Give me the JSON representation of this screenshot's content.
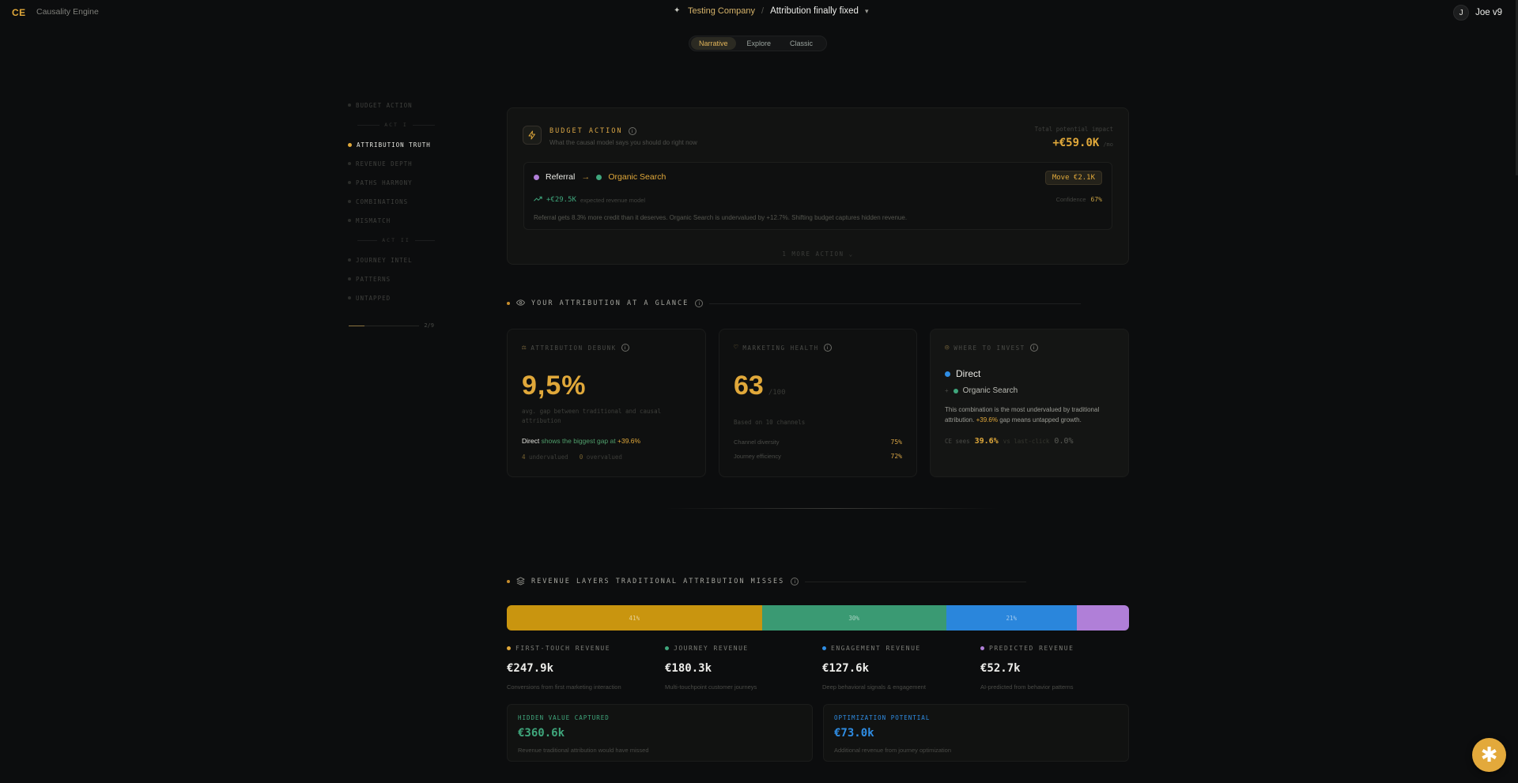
{
  "app": {
    "logo": "CE",
    "name": "Causality Engine"
  },
  "breadcrumb": {
    "company": "Testing Company",
    "separator": "/",
    "project": "Attribution finally fixed"
  },
  "user": {
    "initial": "J",
    "name": "Joe v9"
  },
  "view_tabs": [
    {
      "label": "Narrative",
      "active": true
    },
    {
      "label": "Explore",
      "active": false
    },
    {
      "label": "Classic",
      "active": false
    }
  ],
  "sidebar": {
    "items": [
      {
        "type": "item",
        "label": "BUDGET ACTION",
        "active": false
      },
      {
        "type": "act",
        "label": "ACT I"
      },
      {
        "type": "item",
        "label": "ATTRIBUTION TRUTH",
        "active": true
      },
      {
        "type": "item",
        "label": "REVENUE DEPTH",
        "active": false
      },
      {
        "type": "item",
        "label": "PATHS HARMONY",
        "active": false
      },
      {
        "type": "item",
        "label": "COMBINATIONS",
        "active": false
      },
      {
        "type": "item",
        "label": "MISMATCH",
        "active": false
      },
      {
        "type": "act",
        "label": "ACT II"
      },
      {
        "type": "item",
        "label": "JOURNEY INTEL",
        "active": false
      },
      {
        "type": "item",
        "label": "PATTERNS",
        "active": false
      },
      {
        "type": "item",
        "label": "UNTAPPED",
        "active": false
      }
    ],
    "progress_label": "2/9",
    "progress_fraction": 0.22
  },
  "budget_action": {
    "title": "BUDGET ACTION",
    "subtitle": "What the causal model says you should do right now",
    "impact_label": "Total potential impact",
    "impact_value": "+€59.0K",
    "impact_unit": "/mo",
    "action": {
      "from": "Referral",
      "from_color": "#b07fd8",
      "to": "Organic Search",
      "to_color": "#3fa67c",
      "move": "Move €2.1K",
      "gain_value": "+€29.5K",
      "gain_label": "expected revenue model",
      "confidence_label": "Confidence",
      "confidence_value": "67%",
      "description": "Referral gets 8.3% more credit than it deserves. Organic Search is undervalued by +12.7%. Shifting budget captures hidden revenue."
    },
    "more_label": "1 MORE ACTION"
  },
  "glance": {
    "title": "YOUR ATTRIBUTION AT A GLANCE",
    "debunk": {
      "title": "ATTRIBUTION DEBUNK",
      "value": "9,5%",
      "subtitle": "avg. gap between traditional and causal attribution",
      "gap_channel": "Direct",
      "gap_text": "shows the biggest gap at",
      "gap_value": "+39.6%",
      "undervalued_count": "4",
      "undervalued_label": "undervalued",
      "overvalued_count": "0",
      "overvalued_label": "overvalued"
    },
    "health": {
      "title": "MARKETING HEALTH",
      "value": "63",
      "denominator": "/100",
      "subtitle": "Based on 10 channels",
      "metrics": [
        {
          "label": "Channel diversity",
          "value": "75%"
        },
        {
          "label": "Journey efficiency",
          "value": "72%"
        }
      ]
    },
    "invest": {
      "title": "WHERE TO INVEST",
      "primary": "Direct",
      "primary_color": "#2f8de4",
      "secondary_prefix": "+",
      "secondary": "Organic Search",
      "secondary_color": "#3fa67c",
      "desc_before": "This combination is the most undervalued by traditional attribution.",
      "desc_value": "+39.6%",
      "desc_after": "gap means untapped growth.",
      "ce_label": "CE sees",
      "ce_value": "39.6%",
      "vs_label": "vs last-click",
      "lc_value": "0.0%"
    }
  },
  "revenue": {
    "title": "REVENUE LAYERS TRADITIONAL ATTRIBUTION MISSES",
    "segments": [
      {
        "label": "41%",
        "share": 41,
        "color": "#c9950f"
      },
      {
        "label": "30%",
        "share": 29.6,
        "color": "#3a9a73"
      },
      {
        "label": "21%",
        "share": 21,
        "color": "#2a86dc"
      },
      {
        "label": "",
        "share": 8.4,
        "color": "#b07fd8"
      }
    ],
    "layers": [
      {
        "title": "FIRST-TOUCH REVENUE",
        "value": "€247.9k",
        "desc": "Conversions from first marketing interaction",
        "color": "#e0a83a"
      },
      {
        "title": "JOURNEY REVENUE",
        "value": "€180.3k",
        "desc": "Multi-touchpoint customer journeys",
        "color": "#3fa67c"
      },
      {
        "title": "ENGAGEMENT REVENUE",
        "value": "€127.6k",
        "desc": "Deep behavioral signals & engagement",
        "color": "#2f8de4"
      },
      {
        "title": "PREDICTED REVENUE",
        "value": "€52.7k",
        "desc": "AI-predicted from behavior patterns",
        "color": "#b07fd8"
      }
    ],
    "hidden": {
      "title": "HIDDEN VALUE CAPTURED",
      "value": "€360.6k",
      "desc": "Revenue traditional attribution would have missed",
      "color": "#3fa67c"
    },
    "optimization": {
      "title": "OPTIMIZATION POTENTIAL",
      "value": "€73.0k",
      "desc": "Additional revenue from journey optimization",
      "color": "#2f8de4"
    }
  },
  "icons": {
    "fab": "asterisk-icon",
    "budget": "bolt-icon",
    "glance": "eye-icon",
    "debunk": "scale-icon",
    "health": "heart-icon",
    "invest": "compass-icon",
    "revenue": "layers-icon"
  }
}
